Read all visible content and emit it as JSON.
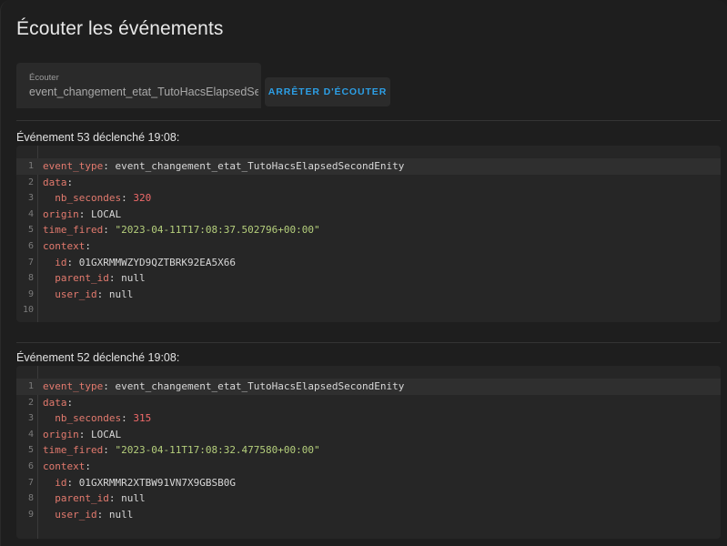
{
  "page": {
    "title": "Écouter les événements"
  },
  "listen": {
    "label": "Écouter",
    "value": "event_changement_etat_TutoHacsElapsedSecondEnity",
    "stop_button": "ARRÊTER D'ÉCOUTER"
  },
  "colors": {
    "accent": "#2c9fe6",
    "key": "#e37a6e",
    "string": "#b5cf7c",
    "number": "#f06a6a"
  },
  "events": [
    {
      "title": "Événement 53 déclenché 19:08:",
      "lines": [
        {
          "n": "1",
          "key": "event_type",
          "sep": ": ",
          "val": "event_changement_etat_TutoHacsElapsedSecondEnity",
          "vt": "p"
        },
        {
          "n": "2",
          "key": "data",
          "sep": ":",
          "val": "",
          "vt": "p"
        },
        {
          "n": "3",
          "indent": "  ",
          "key": "nb_secondes",
          "sep": ": ",
          "val": "320",
          "vt": "n"
        },
        {
          "n": "4",
          "key": "origin",
          "sep": ": ",
          "val": "LOCAL",
          "vt": "p"
        },
        {
          "n": "5",
          "key": "time_fired",
          "sep": ": ",
          "val": "\"2023-04-11T17:08:37.502796+00:00\"",
          "vt": "s"
        },
        {
          "n": "6",
          "key": "context",
          "sep": ":",
          "val": "",
          "vt": "p"
        },
        {
          "n": "7",
          "indent": "  ",
          "key": "id",
          "sep": ": ",
          "val": "01GXRMMWZYD9QZTBRK92EA5X66",
          "vt": "p"
        },
        {
          "n": "8",
          "indent": "  ",
          "key": "parent_id",
          "sep": ": ",
          "val": "null",
          "vt": "p"
        },
        {
          "n": "9",
          "indent": "  ",
          "key": "user_id",
          "sep": ": ",
          "val": "null",
          "vt": "p"
        },
        {
          "n": "10",
          "key": "",
          "sep": "",
          "val": "",
          "vt": "p"
        }
      ]
    },
    {
      "title": "Événement 52 déclenché 19:08:",
      "lines": [
        {
          "n": "1",
          "key": "event_type",
          "sep": ": ",
          "val": "event_changement_etat_TutoHacsElapsedSecondEnity",
          "vt": "p"
        },
        {
          "n": "2",
          "key": "data",
          "sep": ":",
          "val": "",
          "vt": "p"
        },
        {
          "n": "3",
          "indent": "  ",
          "key": "nb_secondes",
          "sep": ": ",
          "val": "315",
          "vt": "n"
        },
        {
          "n": "4",
          "key": "origin",
          "sep": ": ",
          "val": "LOCAL",
          "vt": "p"
        },
        {
          "n": "5",
          "key": "time_fired",
          "sep": ": ",
          "val": "\"2023-04-11T17:08:32.477580+00:00\"",
          "vt": "s"
        },
        {
          "n": "6",
          "key": "context",
          "sep": ":",
          "val": "",
          "vt": "p"
        },
        {
          "n": "7",
          "indent": "  ",
          "key": "id",
          "sep": ": ",
          "val": "01GXRMMR2XTBW91VN7X9GBSB0G",
          "vt": "p"
        },
        {
          "n": "8",
          "indent": "  ",
          "key": "parent_id",
          "sep": ": ",
          "val": "null",
          "vt": "p"
        },
        {
          "n": "9",
          "indent": "  ",
          "key": "user_id",
          "sep": ": ",
          "val": "null",
          "vt": "p"
        }
      ]
    }
  ]
}
